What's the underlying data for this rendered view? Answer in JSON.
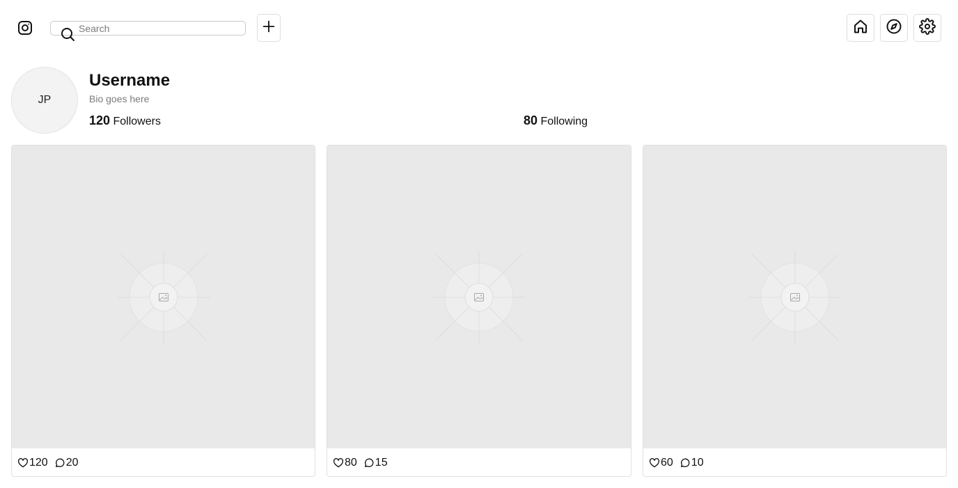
{
  "header": {
    "logo_icon": "instagram-icon",
    "search": {
      "placeholder": "Search",
      "value": "",
      "icon": "search-icon"
    },
    "add_icon": "plus-icon",
    "nav_icons": [
      "home-icon",
      "compass-icon",
      "gear-icon"
    ]
  },
  "profile": {
    "initials": "JP",
    "username": "Username",
    "bio": "Bio goes here",
    "followers_count": "120",
    "followers_label": "Followers",
    "following_count": "80",
    "following_label": "Following"
  },
  "posts": [
    {
      "likes": "120",
      "comments": "20",
      "image_icon": "image-placeholder-icon"
    },
    {
      "likes": "80",
      "comments": "15",
      "image_icon": "image-placeholder-icon"
    },
    {
      "likes": "60",
      "comments": "10",
      "image_icon": "image-placeholder-icon"
    }
  ],
  "colors": {
    "placeholder_bg": "#e9e9e9",
    "border": "#e0e0e0",
    "muted_text": "#7a7a7a"
  }
}
